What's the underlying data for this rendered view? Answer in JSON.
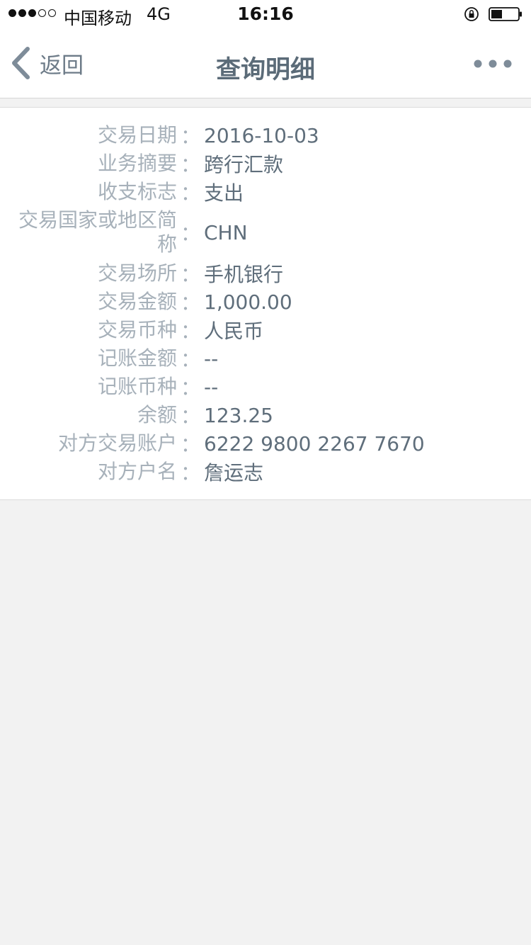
{
  "status_bar": {
    "carrier": "中国移动",
    "network": "4G",
    "time": "16:16",
    "signal_bars_filled": 3,
    "signal_bars_total": 5
  },
  "nav": {
    "back_label": "返回",
    "title": "查询明细",
    "more_icon": "more-dots-icon"
  },
  "details": [
    {
      "label": "交易日期",
      "value": "2016-10-03"
    },
    {
      "label": "业务摘要",
      "value": "跨行汇款"
    },
    {
      "label": "收支标志",
      "value": "支出"
    },
    {
      "label": "交易国家或地区简称",
      "value": "CHN"
    },
    {
      "label": "交易场所",
      "value": "手机银行"
    },
    {
      "label": "交易金额",
      "value": "1,000.00"
    },
    {
      "label": "交易币种",
      "value": "人民币"
    },
    {
      "label": "记账金额",
      "value": "--"
    },
    {
      "label": "记账币种",
      "value": "--"
    },
    {
      "label": "余额",
      "value": "123.25"
    },
    {
      "label": "对方交易账户",
      "value": "6222 9800 2267 7670"
    },
    {
      "label": "对方户名",
      "value": "詹运志"
    }
  ],
  "colors": {
    "label": "#a7b1ba",
    "value": "#5f6e7b",
    "title": "#5b6b78",
    "background": "#f2f2f2"
  },
  "colon": "："
}
